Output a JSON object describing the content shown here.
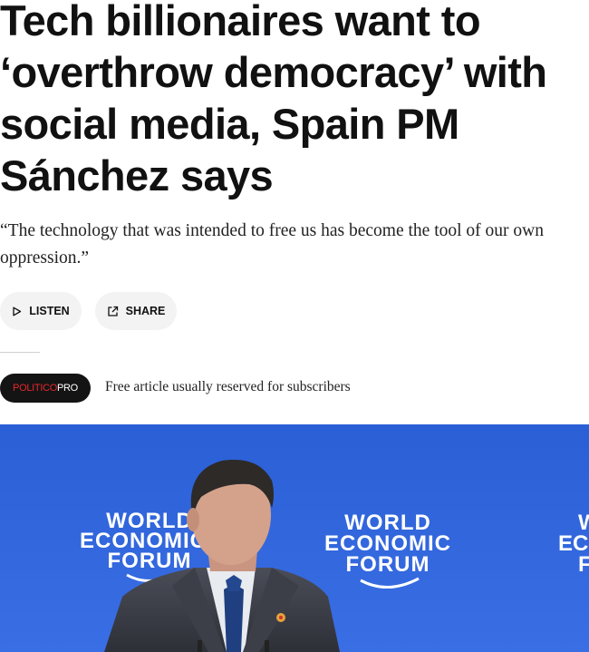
{
  "article": {
    "headline": "Tech billionaires want to ‘overthrow democracy’ with social media, Spain PM Sánchez says",
    "dek": "“The technology that was intended to free us has become the tool of our own oppression.”"
  },
  "actions": {
    "listen_label": "LISTEN",
    "listen_icon": "play-icon",
    "share_label": "SHARE",
    "share_icon": "share-icon"
  },
  "subscription": {
    "badge_brand": "POLITICO",
    "badge_suffix": "PRO",
    "note": "Free article usually reserved for subscribers"
  },
  "photo": {
    "logo_lines": [
      "WORLD",
      "ECONOMIC",
      "FORUM"
    ],
    "background_color": "#2f63d9"
  },
  "colors": {
    "badge_background": "#141414",
    "badge_brand": "#e8262b",
    "pill_background": "#f3f3f3"
  }
}
